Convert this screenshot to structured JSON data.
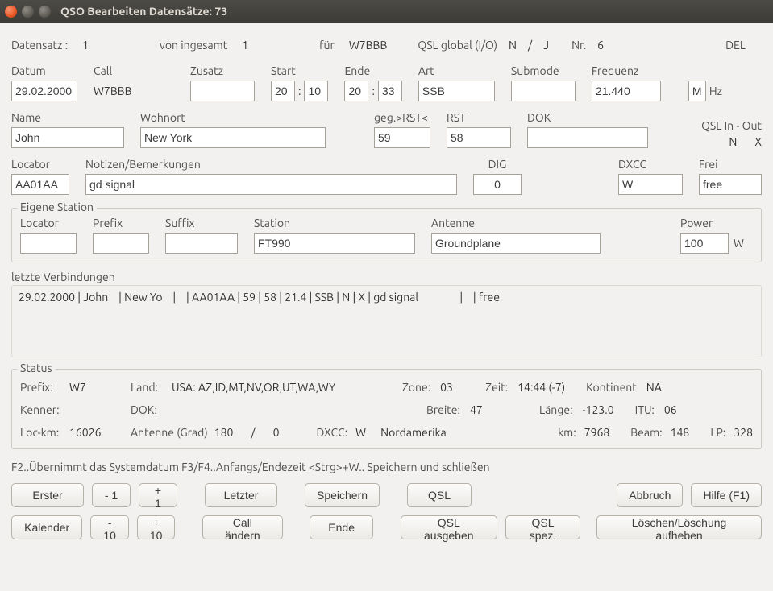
{
  "window": {
    "title": "QSO Bearbeiten  Datensätze: 73"
  },
  "header": {
    "datensatz_label": "Datensatz :",
    "datensatz_value": "1",
    "von_label": "von ingesamt",
    "von_value": "1",
    "fuer_label": "für",
    "fuer_value": "W7BBB",
    "qsl_global_label": "QSL global (I/O)",
    "qsl_global_i": "N",
    "qsl_global_sep": "/",
    "qsl_global_o": "J",
    "nr_label": "Nr.",
    "nr_value": "6",
    "del_label": "DEL"
  },
  "labels": {
    "datum": "Datum",
    "call": "Call",
    "zusatz": "Zusatz",
    "start": "Start",
    "ende": "Ende",
    "art": "Art",
    "submode": "Submode",
    "frequenz": "Frequenz",
    "hz": "Hz",
    "name": "Name",
    "wohnort": "Wohnort",
    "rst_gg": "geg.>RST<",
    "rst": "RST",
    "dok": "DOK",
    "qsl_inout": "QSL In - Out",
    "locator": "Locator",
    "notizen": "Notizen/Bemerkungen",
    "dig": "DIG",
    "dxcc": "DXCC",
    "frei": "Frei",
    "eigene": "Eigene Station",
    "own_locator": "Locator",
    "prefix": "Prefix",
    "suffix": "Suffix",
    "station": "Station",
    "antenne": "Antenne",
    "power": "Power",
    "letzte": "letzte Verbindungen",
    "pw_unit": "W"
  },
  "values": {
    "datum": "29.02.2000",
    "call": "W7BBB",
    "zusatz": "",
    "start_h": "20",
    "start_m": "10",
    "ende_h": "20",
    "ende_m": "33",
    "art": "SSB",
    "submode": "",
    "frequenz": "21.440",
    "freq_unit": "M",
    "name": "John",
    "wohnort": "New York",
    "rst_gg": "59",
    "rst": "58",
    "dok": "",
    "qsl_in": "N",
    "qsl_out": "X",
    "locator": "AA01AA",
    "notizen": "gd signal",
    "dig": "0",
    "dxcc": "W",
    "frei": "free",
    "own_locator": "",
    "prefix": "",
    "suffix": "",
    "station": "FT990",
    "antenne": "Groundplane",
    "power": "100"
  },
  "lastconn": "29.02.2000 | John    | New Yo    |    | AA01AA | 59 | 58 | 21.4 | SSB | N | X | gd signal                |    | free",
  "status": {
    "title": "Status",
    "prefix_l": "Prefix:",
    "prefix_v": "W7",
    "land_l": "Land:",
    "land_v": "USA: AZ,ID,MT,NV,OR,UT,WA,WY",
    "zone_l": "Zone:",
    "zone_v": "03",
    "zeit_l": "Zeit:",
    "zeit_v": "14:44 (-7)",
    "kontinent_l": "Kontinent",
    "kontinent_v": "NA",
    "kenner_l": "Kenner:",
    "kenner_v": "",
    "dok_l": "DOK:",
    "dok_v": "",
    "breite_l": "Breite:",
    "breite_v": "47",
    "laenge_l": "Länge:",
    "laenge_v": "-123.0",
    "itu_l": "ITU:",
    "itu_v": "06",
    "lockm_l": "Loc-km:",
    "lockm_v": "16026",
    "ant_l": "Antenne (Grad)",
    "ant_v1": "180",
    "ant_sep": "/",
    "ant_v2": "0",
    "dxcc_l": "DXCC:",
    "dxcc_v1": "W",
    "dxcc_v2": "Nordamerika",
    "km_l": "km:",
    "km_v": "7968",
    "beam_l": "Beam:",
    "beam_v": "148",
    "lp_l": "LP:",
    "lp_v": "328"
  },
  "hint": "F2..Übernimmt das Systemdatum     F3/F4..Anfangs/Endezeit <Strg>+W.. Speichern und schließen",
  "buttons": {
    "erster": "Erster",
    "minus1": "- 1",
    "plus1": "+ 1",
    "letzter": "Letzter",
    "speichern": "Speichern",
    "qsl": "QSL",
    "abbruch": "Abbruch",
    "hilfe": "Hilfe (F1)",
    "kalender": "Kalender",
    "minus10": "- 10",
    "plus10": "+ 10",
    "callaendern": "Call ändern",
    "ende": "Ende",
    "qslausgeben": "QSL ausgeben",
    "qslspez": "QSL spez.",
    "loeschen": "Löschen/Löschung aufheben"
  }
}
